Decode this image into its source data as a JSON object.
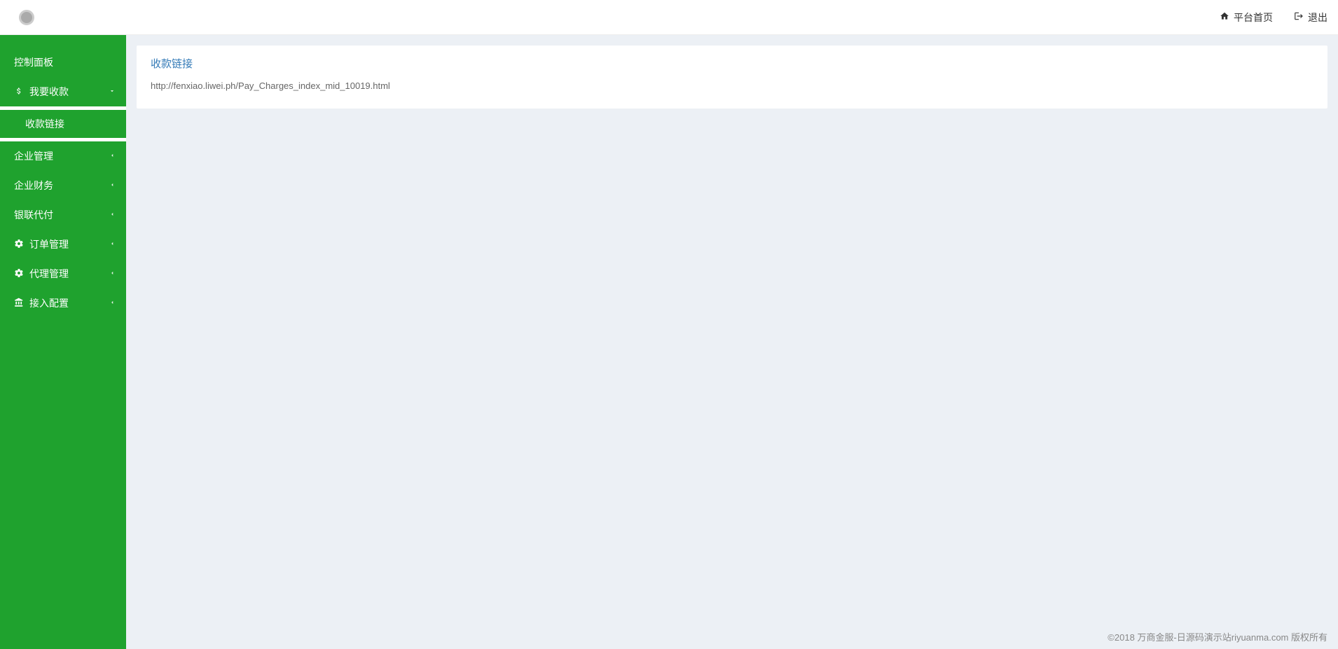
{
  "header": {
    "home_label": "平台首页",
    "logout_label": "退出"
  },
  "sidebar": {
    "dashboard": "控制面板",
    "collect": {
      "label": "我要收款",
      "sub_link": "收款链接"
    },
    "company_mgmt": "企业管理",
    "company_finance": "企业财务",
    "unionpay": "银联代付",
    "order_mgmt": "订单管理",
    "agent_mgmt": "代理管理",
    "access_config": "接入配置"
  },
  "content": {
    "title": "收款链接",
    "link": "http://fenxiao.liwei.ph/Pay_Charges_index_mid_10019.html"
  },
  "footer": {
    "copyright": "©2018 万商金服-日源码演示站riyuanma.com 版权所有"
  }
}
